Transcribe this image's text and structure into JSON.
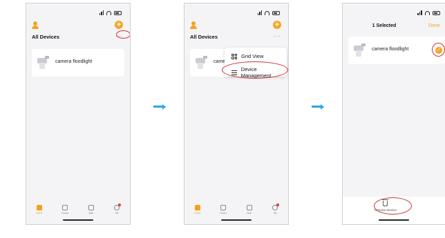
{
  "screen1": {
    "title": "All Devices",
    "more_label": "···",
    "device": "camera floodlight",
    "tabs": [
      {
        "label": "Home",
        "icon": "home-icon"
      },
      {
        "label": "Scene",
        "icon": "scene-icon"
      },
      {
        "label": "Mall",
        "icon": "mall-icon"
      },
      {
        "label": "Me",
        "icon": "me-icon"
      }
    ]
  },
  "screen2": {
    "title": "All Devices",
    "more_label": "···",
    "device": "came",
    "menu": [
      {
        "label": "Grid View",
        "icon": "grid-icon"
      },
      {
        "label": "Device Management",
        "icon": "list-icon"
      }
    ],
    "tabs": [
      {
        "label": "Home"
      },
      {
        "label": "Scene"
      },
      {
        "label": "Mall"
      },
      {
        "label": "Me"
      }
    ]
  },
  "screen3": {
    "header": "1 Selected",
    "done_label": "Done",
    "device": "camera floodlight",
    "remove_label": "Remove Device"
  },
  "colors": {
    "accent": "#f5a623",
    "arrow": "#27a7df",
    "highlight": "#d32f2f"
  }
}
